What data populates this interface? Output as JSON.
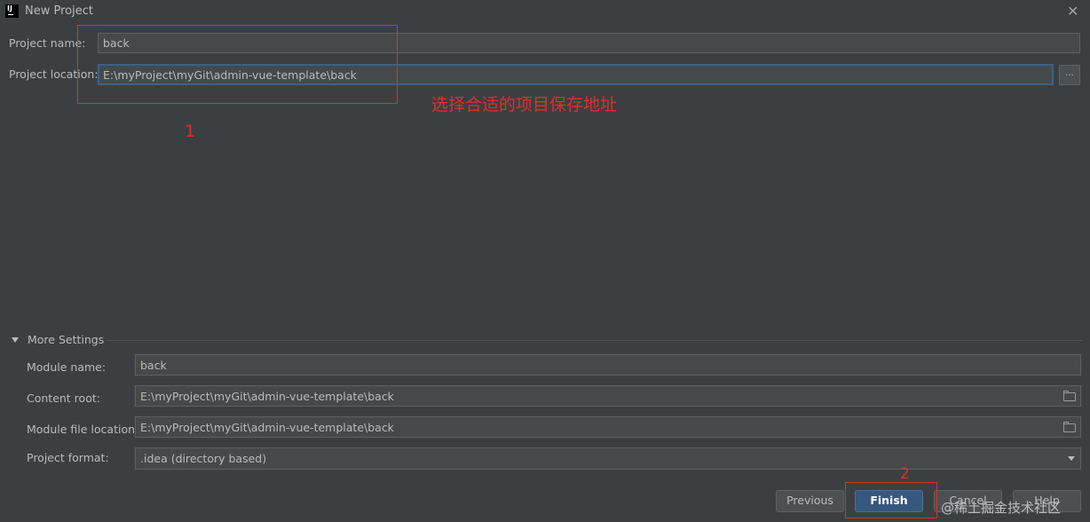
{
  "window": {
    "title": "New Project",
    "app_icon": "IJ",
    "close_glyph": "✕"
  },
  "project": {
    "name_label": "Project name:",
    "name_value": "back",
    "location_label": "Project location:",
    "location_value": "E:\\myProject\\myGit\\admin-vue-template\\back",
    "browse_label": "..."
  },
  "annotations": {
    "box1_number": "1",
    "box1_note": "选择合适的项目保存地址",
    "box2_number": "2",
    "color": "#e0302c"
  },
  "more_settings": {
    "title": "More Settings",
    "module_name_label": "Module name:",
    "module_name_value": "back",
    "content_root_label": "Content root:",
    "content_root_value": "E:\\myProject\\myGit\\admin-vue-template\\back",
    "module_file_label": "Module file location:",
    "module_file_value": "E:\\myProject\\myGit\\admin-vue-template\\back",
    "format_label": "Project format:",
    "format_value": ".idea (directory based)"
  },
  "buttons": {
    "previous": "Previous",
    "finish": "Finish",
    "cancel": "Cancel",
    "help": "Help"
  },
  "watermark": "@稀土掘金技术社区",
  "colors": {
    "background": "#3c3f41",
    "field": "#45494a",
    "primary": "#365880"
  }
}
